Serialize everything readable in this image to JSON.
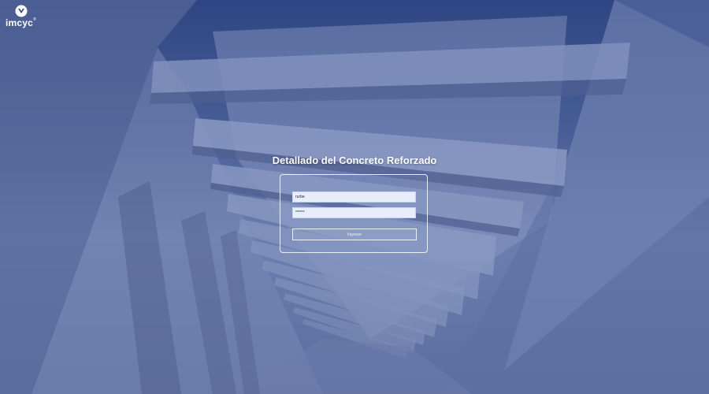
{
  "brand": {
    "logo_text": "imcyc",
    "logo_registered": "®"
  },
  "page": {
    "title": "Detallado del Concreto Reforzado"
  },
  "login": {
    "username_value": "rurbe",
    "password_value": "******",
    "submit_label": "Ingresar"
  },
  "colors": {
    "overlay_top": "#2e4683",
    "overlay_mid": "#6a7eaf",
    "text": "#ffffff",
    "field_bg": "#e8edfb"
  }
}
